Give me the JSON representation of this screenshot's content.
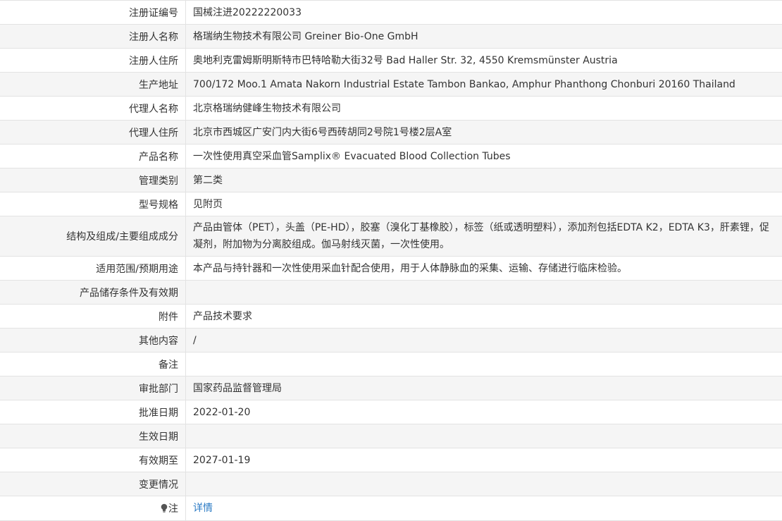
{
  "record": {
    "rows": [
      {
        "label": "注册证编号",
        "value": "国械注进20222220033"
      },
      {
        "label": "注册人名称",
        "value": "格瑞纳生物技术有限公司 Greiner Bio-One GmbH"
      },
      {
        "label": "注册人住所",
        "value": "奥地利克雷姆斯明斯特市巴特哈勒大街32号 Bad Haller Str. 32, 4550 Kremsmünster Austria"
      },
      {
        "label": "生产地址",
        "value": "700/172 Moo.1 Amata Nakorn Industrial Estate Tambon Bankao, Amphur Phanthong Chonburi 20160 Thailand"
      },
      {
        "label": "代理人名称",
        "value": "北京格瑞纳健峰生物技术有限公司"
      },
      {
        "label": "代理人住所",
        "value": "北京市西城区广安门内大街6号西砖胡同2号院1号楼2层A室"
      },
      {
        "label": "产品名称",
        "value": "一次性使用真空采血管Samplix® Evacuated Blood Collection Tubes"
      },
      {
        "label": "管理类别",
        "value": "第二类"
      },
      {
        "label": "型号规格",
        "value": "见附页"
      },
      {
        "label": "结构及组成/主要组成成分",
        "value": "产品由管体（PET），头盖（PE-HD），胶塞（溴化丁基橡胶），标签（纸或透明塑料），添加剂包括EDTA K2，EDTA K3，肝素锂，促凝剂，附加物为分离胶组成。伽马射线灭菌，一次性使用。"
      },
      {
        "label": "适用范围/预期用途",
        "value": "本产品与持针器和一次性使用采血针配合使用，用于人体静脉血的采集、运输、存储进行临床检验。"
      },
      {
        "label": "产品储存条件及有效期",
        "value": ""
      },
      {
        "label": "附件",
        "value": "产品技术要求"
      },
      {
        "label": "其他内容",
        "value": "/"
      },
      {
        "label": "备注",
        "value": ""
      },
      {
        "label": "审批部门",
        "value": "国家药品监督管理局"
      },
      {
        "label": "批准日期",
        "value": "2022-01-20"
      },
      {
        "label": "生效日期",
        "value": ""
      },
      {
        "label": "有效期至",
        "value": "2027-01-19"
      },
      {
        "label": "变更情况",
        "value": ""
      }
    ],
    "note": {
      "label": "注",
      "icon": "bulb-icon",
      "link_text": "详情",
      "link_color": "#2a7ac4"
    }
  }
}
